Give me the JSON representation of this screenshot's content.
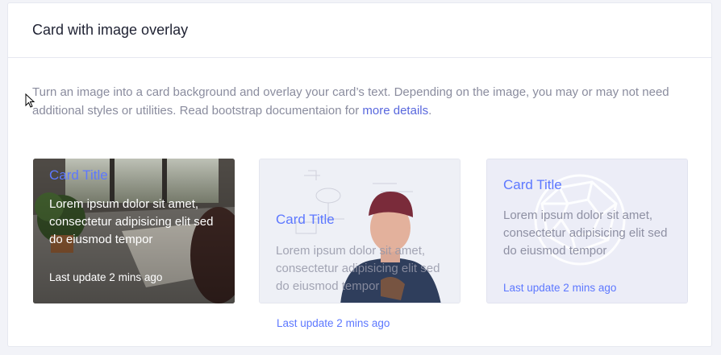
{
  "header": {
    "title": "Card with image overlay"
  },
  "description": {
    "text": "Turn an image into a card background and overlay your card’s text. Depending on the image, you may or may not need additional styles or utilities. Read bootstrap documentaion for ",
    "link": "more details",
    "end": "."
  },
  "cards": [
    {
      "title": "Card Title",
      "body": "Lorem ipsum dolor sit amet, consectetur adipisicing elit sed do eiusmod tempor",
      "update": "Last update 2 mins ago",
      "image": "desk-photo"
    },
    {
      "title": "Card Title",
      "body": "Lorem ipsum dolor sit amet, consectetur adipisicing elit sed do eiusmod tempor",
      "update": "Last update 2 mins ago",
      "image": "man-with-beanie-photo"
    },
    {
      "title": "Card Title",
      "body": "Lorem ipsum dolor sit amet, consectetur adipisicing elit sed do eiusmod tempor",
      "update": "Last update 2 mins ago",
      "image": "geometric-sculpture-photo"
    }
  ],
  "colors": {
    "accent": "#5d78ff",
    "link": "#5867dd",
    "text_muted": "#8a8c9e",
    "title": "#1f2233"
  }
}
